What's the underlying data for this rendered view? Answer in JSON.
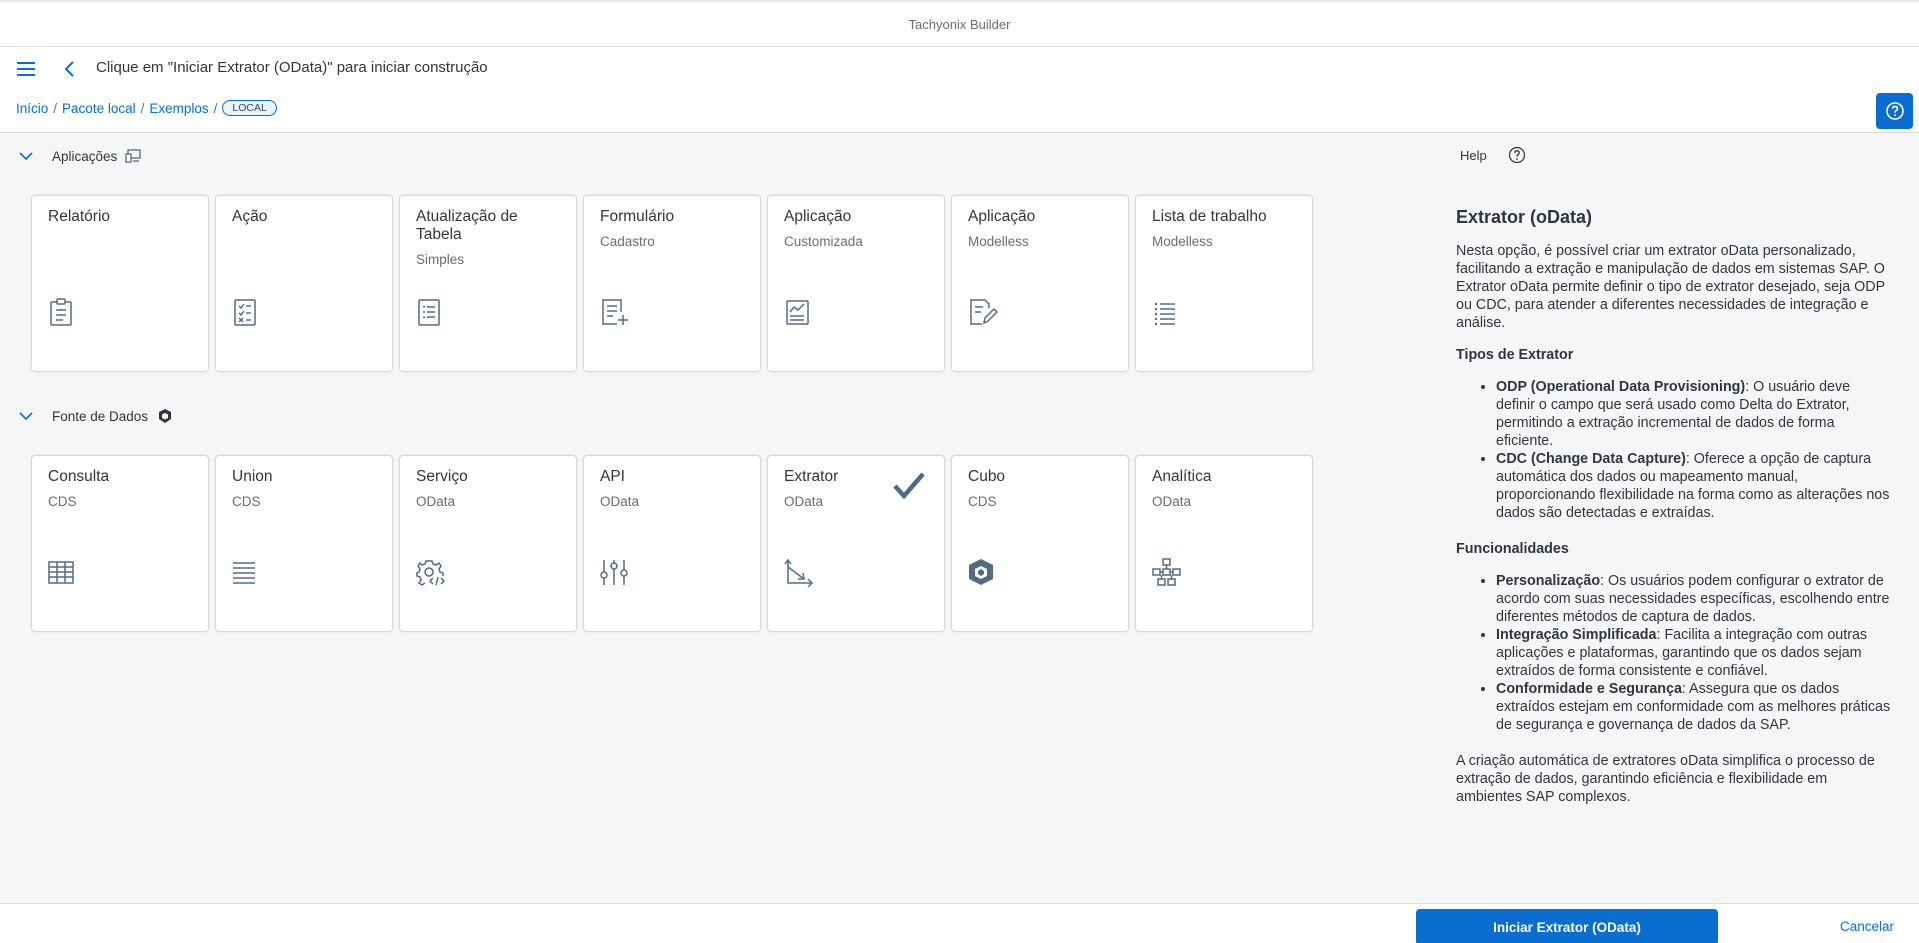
{
  "app": {
    "title": "Tachyonix Builder"
  },
  "header": {
    "title": "Clique em \"Iniciar Extrator (OData)\" para iniciar construção",
    "breadcrumb": [
      "Início",
      "Pacote local",
      "Exemplos"
    ],
    "badge": "LOCAL"
  },
  "sections": {
    "apps": {
      "label": "Aplicações",
      "tiles": [
        {
          "title": "Relatório",
          "subtitle": "",
          "icon": "clipboard-icon"
        },
        {
          "title": "Ação",
          "subtitle": "",
          "icon": "checklist-icon"
        },
        {
          "title": "Atualização de Tabela",
          "subtitle": "Simples",
          "icon": "document-list-icon"
        },
        {
          "title": "Formulário",
          "subtitle": "Cadastro",
          "icon": "form-add-icon"
        },
        {
          "title": "Aplicação",
          "subtitle": "Customizada",
          "icon": "chart-document-icon"
        },
        {
          "title": "Aplicação",
          "subtitle": "Modelless",
          "icon": "edit-document-icon"
        },
        {
          "title": "Lista de trabalho",
          "subtitle": "Modelless",
          "icon": "bullet-list-icon"
        }
      ]
    },
    "data": {
      "label": "Fonte de Dados",
      "tiles": [
        {
          "title": "Consulta",
          "subtitle": "CDS",
          "icon": "table-grid-icon"
        },
        {
          "title": "Union",
          "subtitle": "CDS",
          "icon": "lines-icon"
        },
        {
          "title": "Serviço",
          "subtitle": "OData",
          "icon": "gear-code-icon"
        },
        {
          "title": "API",
          "subtitle": "OData",
          "icon": "sliders-icon"
        },
        {
          "title": "Extrator",
          "subtitle": "OData",
          "icon": "axis-arrow-icon",
          "selected": true
        },
        {
          "title": "Cubo",
          "subtitle": "CDS",
          "icon": "cube-icon"
        },
        {
          "title": "Analítica",
          "subtitle": "OData",
          "icon": "network-icon"
        }
      ]
    }
  },
  "help": {
    "label": "Help",
    "title": "Extrator (oData)",
    "intro": "Nesta opção, é possível criar um extrator oData personalizado, facilitando a extração e manipulação de dados em sistemas SAP. O Extrator oData permite definir o tipo de extrator desejado, seja ODP ou CDC, para atender a diferentes necessidades de integração e análise.",
    "types_heading": "Tipos de Extrator",
    "types": [
      {
        "term": "ODP (Operational Data Provisioning)",
        "desc": ": O usuário deve definir o campo que será usado como Delta do Extrator, permitindo a extração incremental de dados de forma eficiente."
      },
      {
        "term": "CDC (Change Data Capture)",
        "desc": ": Oferece a opção de captura automática dos dados ou mapeamento manual, proporcionando flexibilidade na forma como as alterações nos dados são detectadas e extraídas."
      }
    ],
    "features_heading": "Funcionalidades",
    "features": [
      {
        "term": "Personalização",
        "desc": ": Os usuários podem configurar o extrator de acordo com suas necessidades específicas, escolhendo entre diferentes métodos de captura de dados."
      },
      {
        "term": "Integração Simplificada",
        "desc": ": Facilita a integração com outras aplicações e plataformas, garantindo que os dados sejam extraídos de forma consistente e confiável."
      },
      {
        "term": "Conformidade e Segurança",
        "desc": ": Assegura que os dados extraídos estejam em conformidade com as melhores práticas de segurança e governança de dados da SAP."
      }
    ],
    "conclusion": "A criação automática de extratores oData simplifica o processo de extração de dados, garantindo eficiência e flexibilidade em ambientes SAP complexos."
  },
  "footer": {
    "primary": "Iniciar Extrator (OData)",
    "cancel": "Cancelar"
  },
  "colors": {
    "accent": "#0a6ed1",
    "icon": "#556b82",
    "check": "#4c6a8c"
  }
}
